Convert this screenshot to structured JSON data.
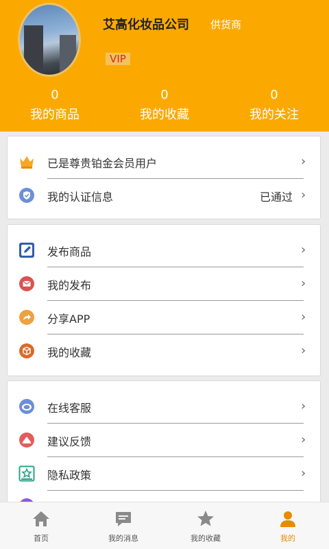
{
  "profile": {
    "company": "艾高化妆品公司",
    "role": "供货商",
    "badge": "VIP"
  },
  "stats": [
    {
      "count": "0",
      "label": "我的商品"
    },
    {
      "count": "0",
      "label": "我的收藏"
    },
    {
      "count": "0",
      "label": "我的关注"
    }
  ],
  "section1": [
    {
      "label": "已是尊贵铂金会员用户",
      "icon": "crown-icon"
    },
    {
      "label": "我的认证信息",
      "value": "已通过",
      "icon": "shield-icon"
    }
  ],
  "section2": [
    {
      "label": "发布商品",
      "icon": "edit-icon"
    },
    {
      "label": "我的发布",
      "icon": "mail-icon"
    },
    {
      "label": "分享APP",
      "icon": "share-icon"
    },
    {
      "label": "我的收藏",
      "icon": "box-icon"
    }
  ],
  "section3": [
    {
      "label": "在线客服",
      "icon": "headset-icon"
    },
    {
      "label": "建议反馈",
      "icon": "feedback-icon"
    },
    {
      "label": "隐私政策",
      "icon": "policy-icon"
    }
  ],
  "tabs": [
    {
      "label": "首页",
      "icon": "home-icon"
    },
    {
      "label": "我的消息",
      "icon": "message-icon"
    },
    {
      "label": "我的收藏",
      "icon": "star-icon"
    },
    {
      "label": "我的",
      "icon": "person-icon",
      "active": true
    }
  ],
  "colors": {
    "header": "#fba900",
    "active_tab": "#e88b00",
    "crown": "#f5a623",
    "shield": "#6c8fd8",
    "edit": "#2f5fa8",
    "mail": "#d9534f",
    "share": "#f0a040",
    "box": "#d96b2b",
    "headset": "#6c8fd8",
    "feedback": "#e35d5d",
    "policy": "#2aa38a"
  }
}
